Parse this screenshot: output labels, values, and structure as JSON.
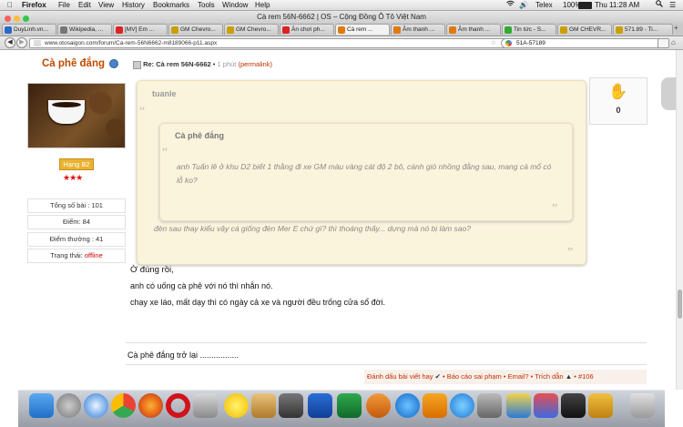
{
  "menubar": {
    "app": "Firefox",
    "items": [
      "File",
      "Edit",
      "View",
      "History",
      "Bookmarks",
      "Tools",
      "Window",
      "Help"
    ],
    "right": {
      "input_method": "Telex",
      "battery": "100%",
      "clock": "Thu 11:28 AM"
    }
  },
  "window": {
    "title": "Cà rem 56N-6662 | OS – Cộng Đồng Ô Tô Việt Nam"
  },
  "tabs": [
    {
      "label": "DuyLinh.vn...",
      "color": "#2a6ac8"
    },
    {
      "label": "Wikipedia, ...",
      "color": "#777"
    },
    {
      "label": "[MV] Em ...",
      "color": "#d22"
    },
    {
      "label": "GM Chevro...",
      "color": "#c9a000"
    },
    {
      "label": "GM Chevro...",
      "color": "#c9a000"
    },
    {
      "label": "Ăn chơi ph...",
      "color": "#d22"
    },
    {
      "label": "Cà rem ...",
      "color": "#e07a10",
      "active": true
    },
    {
      "label": "Âm thanh ...",
      "color": "#e07a10"
    },
    {
      "label": "Âm thanh ...",
      "color": "#e07a10"
    },
    {
      "label": "Tin tức - S...",
      "color": "#3a3"
    },
    {
      "label": "GM CHEVR...",
      "color": "#c9a000"
    },
    {
      "label": "571.89 - Ti...",
      "color": "#c9a000"
    }
  ],
  "nav": {
    "url": "www.otosaigon.com/forum/Ca-rem-56N6662-m8189066-p11.aspx",
    "search": "51A-57189"
  },
  "post": {
    "author": "Cà phê đắng",
    "rank": "Hạng B2",
    "stats": [
      {
        "label": "Tổng số bài :",
        "value": "101"
      },
      {
        "label": "Điểm:",
        "value": "84"
      },
      {
        "label": "Điểm thưởng :",
        "value": "41"
      }
    ],
    "status_label": "Trạng thái:",
    "status_value": "offline",
    "reply_title": "Re: Cà rem 56N-6662",
    "time": "1 phút",
    "permalink": "(permalink)",
    "quote_outer": {
      "author": "tuanle",
      "text": "đèn sau thay kiểu vậy cá giống đèn Mer E chứ gì? thì thoáng thấy... dưng mà nó bị làm sao?"
    },
    "quote_inner": {
      "author": "Cà phê đắng",
      "text": "anh Tuấn lê ở khu D2 biết 1 thằng đi xe GM màu vàng cát độ 2 bô, cánh gió nhồng đằng sau, mang cá mổ có lỗ ko?"
    },
    "like_count": "0",
    "body": [
      "Ờ đúng rồi,",
      "anh có uống cà phê với nó thì nhắn nó.",
      "chạy xe láo, mất dạy thì có ngày cả xe và người đều trống cửa sổ đời."
    ],
    "signature": "Cà phê đắng trở lại .................",
    "actions": [
      "Đánh dấu bài viết hay",
      "Báo cáo sai phạm",
      "Email?",
      "Trích dẫn",
      "#106"
    ]
  },
  "colors": {
    "accent": "#c04a00",
    "quote_bg": "#fbf4dc",
    "link": "#c03000",
    "offline": "#d00000",
    "rank_bg": "#e9b230"
  }
}
